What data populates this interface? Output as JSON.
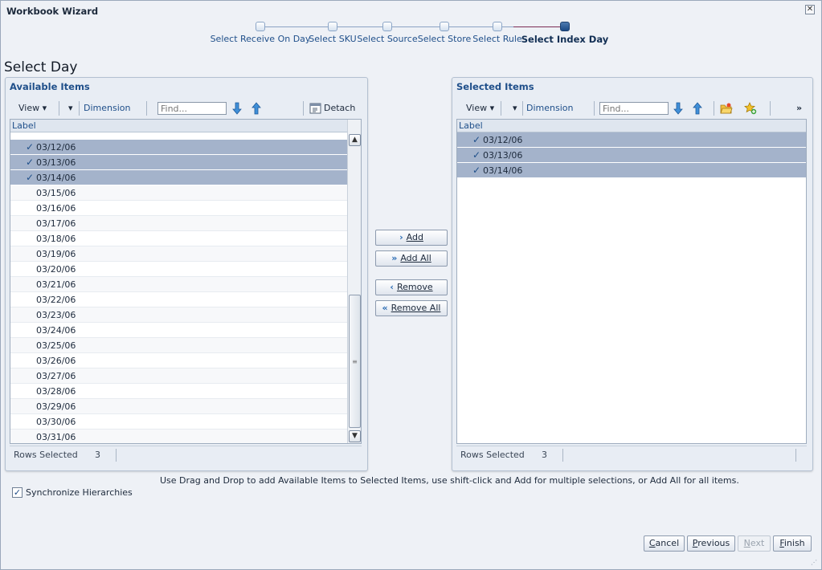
{
  "window": {
    "title": "Workbook Wizard",
    "close_glyph": "✕"
  },
  "train": {
    "steps": [
      {
        "label": "Select Receive On Day"
      },
      {
        "label": "Select SKU"
      },
      {
        "label": "Select Source"
      },
      {
        "label": "Select Store"
      },
      {
        "label": "Select Rule"
      },
      {
        "label": "Select Index Day"
      }
    ],
    "current_index": 5
  },
  "page": {
    "title": "Select Day"
  },
  "available": {
    "header": "Available Items",
    "toolbar": {
      "view": "View ▾",
      "dimension": "Dimension",
      "find_placeholder": "Find...",
      "detach": "Detach"
    },
    "column": "Label",
    "rows": [
      {
        "label": "03/12/06",
        "selected": true
      },
      {
        "label": "03/13/06",
        "selected": true
      },
      {
        "label": "03/14/06",
        "selected": true
      },
      {
        "label": "03/15/06",
        "selected": false
      },
      {
        "label": "03/16/06",
        "selected": false
      },
      {
        "label": "03/17/06",
        "selected": false
      },
      {
        "label": "03/18/06",
        "selected": false
      },
      {
        "label": "03/19/06",
        "selected": false
      },
      {
        "label": "03/20/06",
        "selected": false
      },
      {
        "label": "03/21/06",
        "selected": false
      },
      {
        "label": "03/22/06",
        "selected": false
      },
      {
        "label": "03/23/06",
        "selected": false
      },
      {
        "label": "03/24/06",
        "selected": false
      },
      {
        "label": "03/25/06",
        "selected": false
      },
      {
        "label": "03/26/06",
        "selected": false
      },
      {
        "label": "03/27/06",
        "selected": false
      },
      {
        "label": "03/28/06",
        "selected": false
      },
      {
        "label": "03/29/06",
        "selected": false
      },
      {
        "label": "03/30/06",
        "selected": false
      },
      {
        "label": "03/31/06",
        "selected": false
      }
    ],
    "status": {
      "label": "Rows Selected",
      "count": "3"
    }
  },
  "selected": {
    "header": "Selected Items",
    "toolbar": {
      "view": "View ▾",
      "dimension": "Dimension",
      "find_placeholder": "Find...",
      "more": "»"
    },
    "column": "Label",
    "rows": [
      {
        "label": "03/12/06",
        "selected": true
      },
      {
        "label": "03/13/06",
        "selected": true
      },
      {
        "label": "03/14/06",
        "selected": true
      }
    ],
    "status": {
      "label": "Rows Selected",
      "count": "3"
    }
  },
  "shuttle": {
    "add": "Add",
    "add_all": "Add All",
    "remove": "Remove",
    "remove_all": "Remove All"
  },
  "hint": "Use Drag and Drop to add Available Items to Selected Items, use shift-click and Add for multiple selections, or Add All for all items.",
  "sync": {
    "label": "Synchronize Hierarchies",
    "checked": true
  },
  "footer": {
    "cancel": "Cancel",
    "previous": "Previous",
    "next": "Next",
    "finish": "Finish"
  },
  "colors": {
    "selection": "#a4b3cb",
    "link": "#1f4f8a",
    "train_done": "#7c2c55"
  }
}
